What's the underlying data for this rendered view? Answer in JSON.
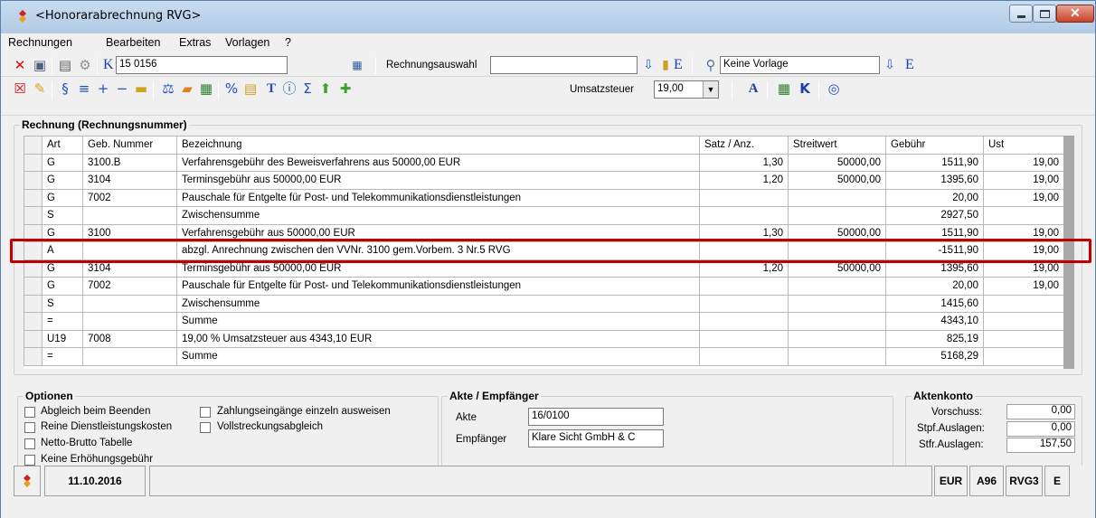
{
  "window": {
    "title": "<Honorarabrechnung RVG>"
  },
  "menu": [
    "Rechnungen",
    "Bearbeiten",
    "Extras",
    "Vorlagen",
    "?"
  ],
  "toolbar1": {
    "k_label": "K",
    "invoice_number": "15 0156",
    "rechnungsauswahl_label": "Rechnungsauswahl",
    "rechnungsauswahl_value": "",
    "e_label": "E",
    "vorlage_value": "Keine Vorlage",
    "e2_label": "E"
  },
  "toolbar2": {
    "umsatzsteuer_label": "Umsatzsteuer",
    "umsatzsteuer_value": "19,00",
    "icons": {
      "paragraph": "§",
      "equals": "≡",
      "plus": "+",
      "minus": "−",
      "percent": "%",
      "t": "T",
      "sigma": "Σ",
      "a": "A"
    }
  },
  "grid": {
    "title": "Rechnung (Rechnungsnummer)",
    "columns": [
      "Art",
      "Geb. Nummer",
      "Bezeichnung",
      "Satz / Anz.",
      "Streitwert",
      "Gebühr",
      "Ust"
    ],
    "rows": [
      [
        "G",
        "3100.B",
        "Verfahrensgebühr des Beweisverfahrens aus 50000,00 EUR",
        "1,30",
        "50000,00",
        "1511,90",
        "19,00"
      ],
      [
        "G",
        "3104",
        "Terminsgebühr aus 50000,00 EUR",
        "1,20",
        "50000,00",
        "1395,60",
        "19,00"
      ],
      [
        "G",
        "7002",
        "Pauschale für Entgelte für Post- und Telekommunikationsdienstleistungen",
        "",
        "",
        "20,00",
        "19,00"
      ],
      [
        "S",
        "",
        "Zwischensumme",
        "",
        "",
        "2927,50",
        ""
      ],
      [
        "G",
        "3100",
        "Verfahrensgebühr aus 50000,00 EUR",
        "1,30",
        "50000,00",
        "1511,90",
        "19,00"
      ],
      [
        "A",
        "",
        "abzgl. Anrechnung zwischen den VVNr. 3100 gem.Vorbem. 3 Nr.5 RVG",
        "",
        "",
        "-1511,90",
        "19,00"
      ],
      [
        "G",
        "3104",
        "Terminsgebühr aus 50000,00 EUR",
        "1,20",
        "50000,00",
        "1395,60",
        "19,00"
      ],
      [
        "G",
        "7002",
        "Pauschale für Entgelte für Post- und Telekommunikationsdienstleistungen",
        "",
        "",
        "20,00",
        "19,00"
      ],
      [
        "S",
        "",
        "Zwischensumme",
        "",
        "",
        "1415,60",
        ""
      ],
      [
        "=",
        "",
        "Summe",
        "",
        "",
        "4343,10",
        ""
      ],
      [
        "U19",
        "7008",
        "19,00 % Umsatzsteuer aus  4343,10 EUR",
        "",
        "",
        "825,19",
        ""
      ],
      [
        "=",
        "",
        "Summe",
        "",
        "",
        "5168,29",
        ""
      ]
    ],
    "highlight_color": "#c00000"
  },
  "optionen": {
    "title": "Optionen",
    "items": [
      "Abgleich beim Beenden",
      "Reine Dienstleistungskosten",
      "Netto-Brutto Tabelle",
      "Keine Erhöhungsgebühr",
      "Zahlungseingänge einzeln ausweisen",
      "Vollstreckungsabgleich"
    ]
  },
  "akte": {
    "title": "Akte / Empfänger",
    "akte_label": "Akte",
    "akte_value": "16/0100",
    "empfaenger_label": "Empfänger",
    "empfaenger_value": "Klare Sicht GmbH & C"
  },
  "aktenkonto": {
    "title": "Aktenkonto",
    "vorschuss_label": "Vorschuss:",
    "vorschuss_value": "0,00",
    "stpf_label": "Stpf.Auslagen:",
    "stpf_value": "0,00",
    "stfr_label": "Stfr.Auslagen:",
    "stfr_value": "157,50"
  },
  "status": {
    "date": "11.10.2016",
    "currency": "EUR",
    "a96": "A96",
    "rvg": "RVG3",
    "e": "E"
  }
}
